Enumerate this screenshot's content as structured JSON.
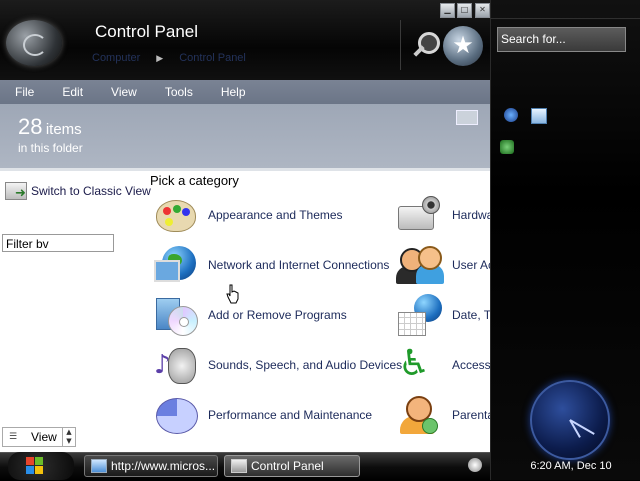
{
  "window": {
    "title": "Control Panel",
    "breadcrumb": [
      "Computer",
      "Control Panel"
    ],
    "controls": {
      "minimize": "▁",
      "maximize": "□",
      "close": "✕"
    }
  },
  "menu": [
    "File",
    "Edit",
    "View",
    "Tools",
    "Help"
  ],
  "info": {
    "count": "28",
    "count_label": "items",
    "subtitle": "in this folder"
  },
  "left_pane": {
    "switch_view": "Switch to Classic View",
    "filter_value": "Filter bv",
    "view_button": "View"
  },
  "heading": "Pick a category",
  "categories_left": [
    {
      "label": "Appearance and Themes",
      "icon": "appearance-palette-icon"
    },
    {
      "label": "Network and Internet Connections",
      "icon": "network-globe-icon"
    },
    {
      "label": "Add or Remove Programs",
      "icon": "programs-cd-icon"
    },
    {
      "label": "Sounds, Speech, and Audio Devices",
      "icon": "sounds-speaker-icon"
    },
    {
      "label": "Performance and Maintenance",
      "icon": "performance-pie-icon"
    }
  ],
  "categories_right": [
    {
      "label": "Hardwa",
      "icon": "hardware-printer-icon"
    },
    {
      "label": "User Ac",
      "icon": "user-accounts-icon"
    },
    {
      "label": "Date, T",
      "icon": "date-time-icon"
    },
    {
      "label": "Accessi",
      "icon": "accessibility-icon"
    },
    {
      "label": "Parenta",
      "icon": "parental-controls-icon"
    }
  ],
  "sidebar": {
    "search_placeholder": "Search for...",
    "clock_text": "6:20 AM, Dec 10"
  },
  "taskbar": {
    "tasks": [
      {
        "label": "http://www.micros..."
      },
      {
        "label": "Control Panel"
      }
    ]
  },
  "colors": {
    "menubar": "#6b7587",
    "infobar": "#aeb6c3",
    "link": "#1c2a5a",
    "accessibility": "#1f9a2a"
  }
}
